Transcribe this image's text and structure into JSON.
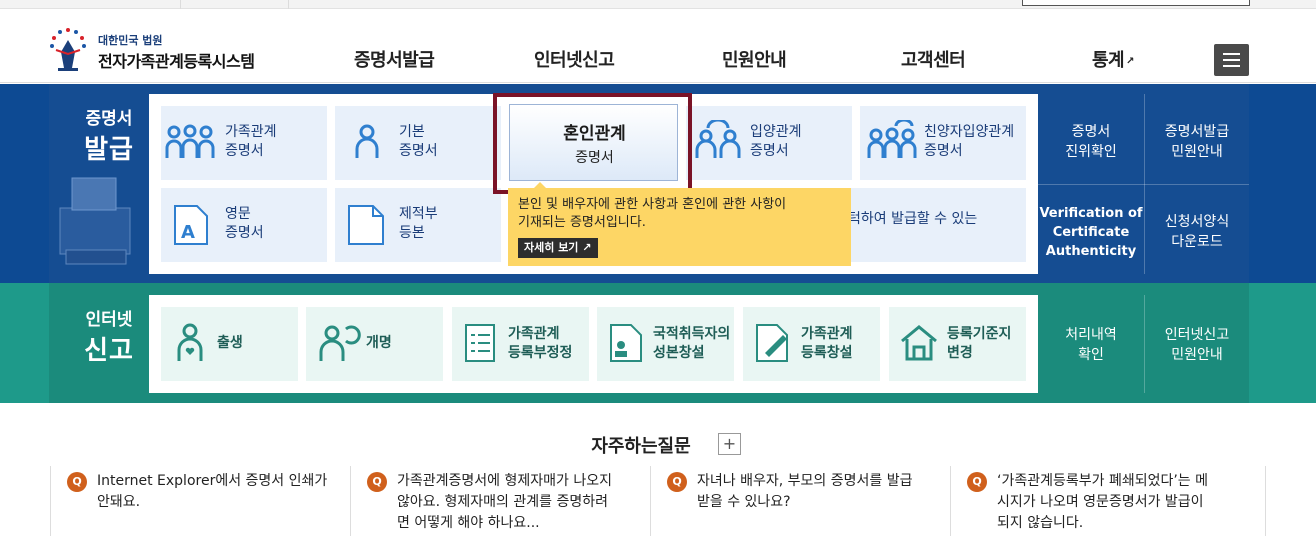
{
  "header": {
    "court": "대한민국 법원",
    "site_name": "전자가족관계등록시스템",
    "nav": [
      {
        "label": "증명서발급"
      },
      {
        "label": "인터넷신고"
      },
      {
        "label": "민원안내"
      },
      {
        "label": "고객센터"
      },
      {
        "label": "통계"
      }
    ]
  },
  "certificate": {
    "section_a": "증명서",
    "section_b": "발급",
    "cards": [
      {
        "line1": "가족관계",
        "line2": "증명서",
        "icon": "family-icon"
      },
      {
        "line1": "기본",
        "line2": "증명서",
        "icon": "person-icon"
      },
      {
        "line1": "입양관계",
        "line2": "증명서",
        "icon": "adoption-icon"
      },
      {
        "line1": "친양자입양관계",
        "line2": "증명서",
        "icon": "family-adoption-icon"
      },
      {
        "line1": "영문",
        "line2": "증명서",
        "icon": "english-doc-icon"
      },
      {
        "line1": "제적부",
        "line2": "등본",
        "icon": "register-doc-icon"
      }
    ],
    "active": {
      "line1": "혼인관계",
      "line2": "증명서"
    },
    "tooltip_line1": "본인 및 배우자에 관한 사항과 혼인에 관한 사항이",
    "tooltip_line2": "기재되는 증명서입니다.",
    "tooltip_more": "자세히 보기",
    "partial_text": "턱하여 발급할 수 있는",
    "side": [
      {
        "line1": "증명서",
        "line2": "진위확인"
      },
      {
        "line1": "증명서발급",
        "line2": "민원안내"
      },
      {
        "line1": "Verification of",
        "line2": "Certificate",
        "line3": "Authenticity"
      },
      {
        "line1": "신청서양식",
        "line2": "다운로드"
      }
    ]
  },
  "report": {
    "section_a": "인터넷",
    "section_b": "신고",
    "cards": [
      {
        "line1": "출생",
        "line2": ""
      },
      {
        "line1": "개명",
        "line2": ""
      },
      {
        "line1": "가족관계",
        "line2": "등록부정정"
      },
      {
        "line1": "국적취득자의",
        "line2": "성본창설"
      },
      {
        "line1": "가족관계",
        "line2": "등록창설"
      },
      {
        "line1": "등록기준지",
        "line2": "변경"
      }
    ],
    "side": [
      {
        "line1": "처리내역",
        "line2": "확인"
      },
      {
        "line1": "인터넷신고",
        "line2": "민원안내"
      }
    ]
  },
  "faq": {
    "title": "자주하는질문",
    "plus": "+",
    "badge": "Q",
    "items": [
      {
        "line1": "Internet Explorer에서 증명서 인쇄가",
        "line2": "안돼요.",
        "line3": ""
      },
      {
        "line1": "가족관계증명서에 형제자매가 나오지",
        "line2": "않아요. 형제자매의 관계를 증명하려",
        "line3": "면 어떻게 해야 하나요..."
      },
      {
        "line1": "자녀나 배우자, 부모의 증명서를 발급",
        "line2": "받을 수 있나요?",
        "line3": ""
      },
      {
        "line1": "‘가족관계등록부가 폐쇄되었다’는 메",
        "line2": "시지가 나오며 영문증명서가 발급이",
        "line3": "되지 않습니다."
      }
    ]
  }
}
